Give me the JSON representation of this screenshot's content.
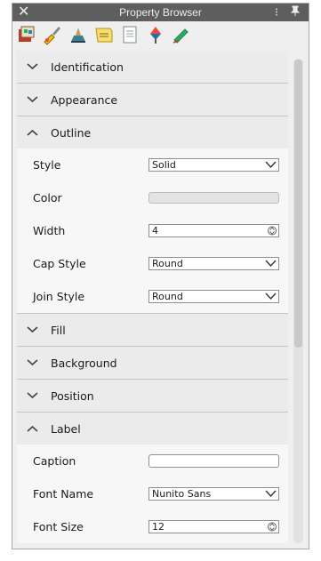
{
  "window": {
    "title": "Property Browser",
    "close_glyph": "✕",
    "menu_glyph": "⁝",
    "pin_glyph": "🖈"
  },
  "toolbar": {
    "icons": [
      "palette-icon",
      "brush-icon",
      "stamp-icon",
      "note-icon",
      "document-icon",
      "dropper-icon",
      "pen-icon"
    ]
  },
  "sections": {
    "identification": {
      "label": "Identification",
      "expanded": false
    },
    "appearance": {
      "label": "Appearance",
      "expanded": false
    },
    "outline": {
      "label": "Outline",
      "expanded": true,
      "style": {
        "label": "Style",
        "value": "Solid"
      },
      "color": {
        "label": "Color",
        "value": ""
      },
      "width": {
        "label": "Width",
        "value": "4"
      },
      "cap_style": {
        "label": "Cap Style",
        "value": "Round"
      },
      "join_style": {
        "label": "Join Style",
        "value": "Round"
      }
    },
    "fill": {
      "label": "Fill",
      "expanded": false
    },
    "background": {
      "label": "Background",
      "expanded": false
    },
    "position": {
      "label": "Position",
      "expanded": false
    },
    "label": {
      "label": "Label",
      "expanded": true,
      "caption": {
        "label": "Caption",
        "value": ""
      },
      "font_name": {
        "label": "Font Name",
        "value": "Nunito Sans"
      },
      "font_size": {
        "label": "Font Size",
        "value": "12"
      }
    }
  },
  "colors": {
    "titlebar": "#5e5e5e",
    "panel": "#efefef",
    "row": "#f7f7f7"
  }
}
